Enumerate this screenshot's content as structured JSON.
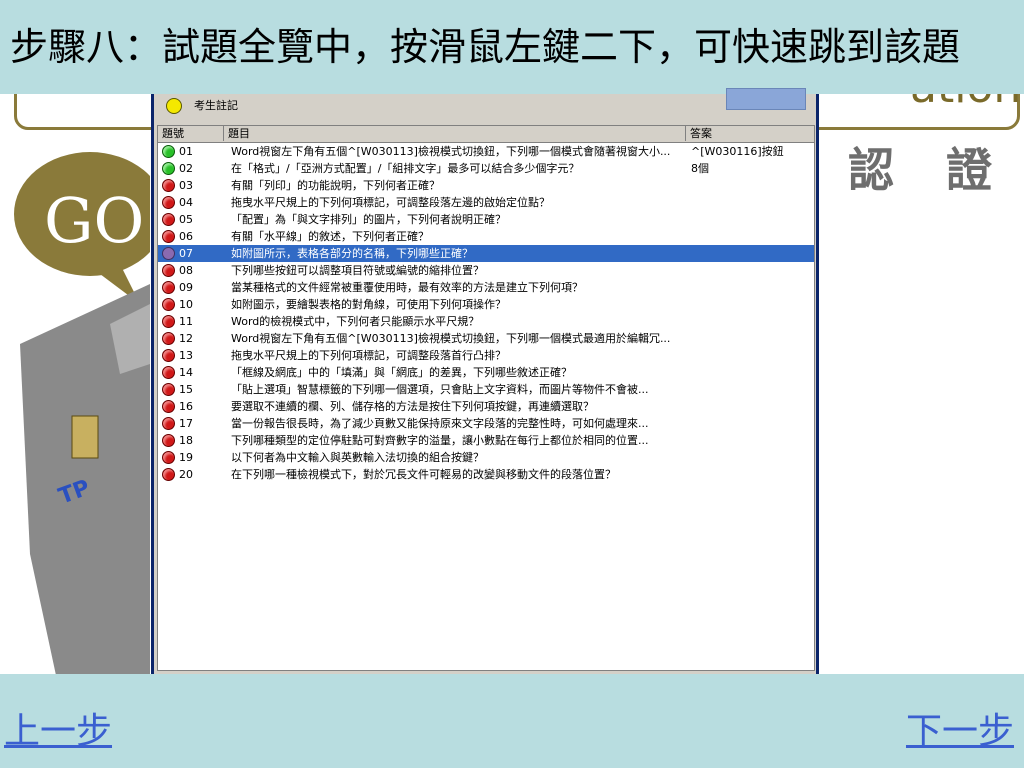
{
  "header": {
    "title": "步驟八：試題全覽中，按滑鼠左鍵二下，可快速跳到該題"
  },
  "background": {
    "right_text": "認 證",
    "go_text": "GO"
  },
  "toolbar": {
    "note_label": "考生註記"
  },
  "list": {
    "columns": [
      "題號",
      "題目",
      "答案"
    ],
    "rows": [
      {
        "num": "01",
        "status": "green",
        "q": "Word視窗左下角有五個^[W030113]檢視模式切換鈕，下列哪一個模式會隨著視窗大小...",
        "a": "^[W030116]按鈕"
      },
      {
        "num": "02",
        "status": "green",
        "q": "在「格式」/「亞洲方式配置」/「組排文字」最多可以結合多少個字元？",
        "a": "8個"
      },
      {
        "num": "03",
        "status": "red",
        "q": "有關「列印」的功能說明，下列何者正確？",
        "a": ""
      },
      {
        "num": "04",
        "status": "red",
        "q": "拖曳水平尺規上的下列何項標記，可調整段落左邊的啟始定位點？",
        "a": ""
      },
      {
        "num": "05",
        "status": "red",
        "q": "「配置」為「與文字排列」的圖片，下列何者說明正確？",
        "a": ""
      },
      {
        "num": "06",
        "status": "red",
        "q": "有關「水平線」的敘述，下列何者正確？",
        "a": ""
      },
      {
        "num": "07",
        "status": "purple",
        "q": "如附圖所示，表格各部分的名稱，下列哪些正確？",
        "a": "",
        "selected": true
      },
      {
        "num": "08",
        "status": "red",
        "q": "下列哪些按鈕可以調整項目符號或編號的縮排位置？",
        "a": ""
      },
      {
        "num": "09",
        "status": "red",
        "q": "當某種格式的文件經常被重覆使用時，最有效率的方法是建立下列何項？",
        "a": ""
      },
      {
        "num": "10",
        "status": "red",
        "q": "如附圖示，要繪製表格的對角線，可使用下列何項操作？",
        "a": ""
      },
      {
        "num": "11",
        "status": "red",
        "q": "Word的檢視模式中，下列何者只能顯示水平尺規？",
        "a": ""
      },
      {
        "num": "12",
        "status": "red",
        "q": "Word視窗左下角有五個^[W030113]檢視模式切換鈕，下列哪一個模式最適用於編輯冗...",
        "a": ""
      },
      {
        "num": "13",
        "status": "red",
        "q": "拖曳水平尺規上的下列何項標記，可調整段落首行凸排？",
        "a": ""
      },
      {
        "num": "14",
        "status": "red",
        "q": "「框線及網底」中的「填滿」與「網底」的差異，下列哪些敘述正確？",
        "a": ""
      },
      {
        "num": "15",
        "status": "red",
        "q": "「貼上選項」智慧標籤的下列哪一個選項，只會貼上文字資料，而圖片等物件不會被...",
        "a": ""
      },
      {
        "num": "16",
        "status": "red",
        "q": "要選取不連續的欄、列、儲存格的方法是按住下列何項按鍵，再連續選取？",
        "a": ""
      },
      {
        "num": "17",
        "status": "red",
        "q": "當一份報告很長時，為了減少頁數又能保持原來文字段落的完整性時，可如何處理來...",
        "a": ""
      },
      {
        "num": "18",
        "status": "red",
        "q": "下列哪種類型的定位停駐點可對齊數字的溢量，讓小數點在每行上都位於相同的位置...",
        "a": ""
      },
      {
        "num": "19",
        "status": "red",
        "q": "以下何者為中文輸入與英數輸入法切換的組合按鍵？",
        "a": ""
      },
      {
        "num": "20",
        "status": "red",
        "q": "在下列哪一種檢視模式下，對於冗長文件可輕易的改變與移動文件的段落位置？",
        "a": ""
      }
    ]
  },
  "nav": {
    "prev_label": "上一步",
    "next_label": "下一步"
  },
  "colors": {
    "band": "#b8dde0",
    "selection": "#316ac5",
    "link": "#3a5fd0"
  }
}
